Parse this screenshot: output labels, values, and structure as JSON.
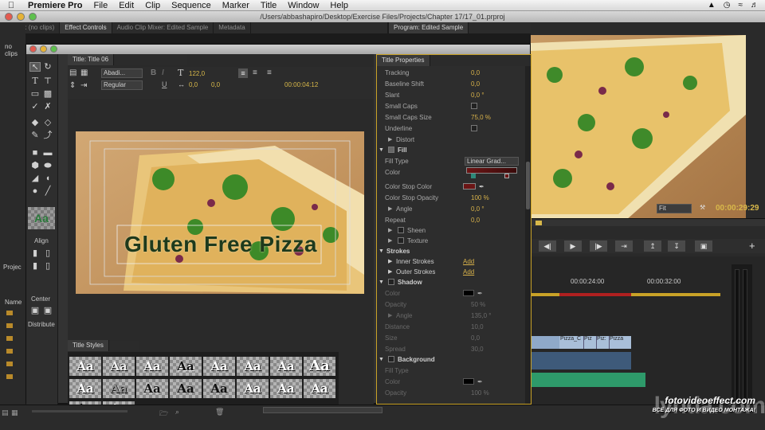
{
  "menubar": {
    "app": "Premiere Pro",
    "items": [
      "File",
      "Edit",
      "Clip",
      "Sequence",
      "Marker",
      "Title",
      "Window",
      "Help"
    ]
  },
  "window_path": "/Users/abbashapiro/Desktop/Exercise Files/Projects/Chapter 17/17_01.prproj",
  "panel_tabs": {
    "source": "Source: (no clips)",
    "effect_controls": "Effect Controls",
    "audio_mixer": "Audio Clip Mixer: Edited Sample",
    "metadata": "Metadata",
    "program": "Program: Edited Sample"
  },
  "left": {
    "no_clips": "no clips",
    "project": "Projec",
    "name": "Name"
  },
  "titler": {
    "tab": "Title: Title 06",
    "font_family": "Abadi...",
    "font_style": "Regular",
    "font_size": "122,0",
    "kerning": "0,0",
    "leading": "0,0",
    "timecode": "00:00:04:12",
    "canvas_text": "Gluten Free Pizza",
    "tools": {
      "align": "Align",
      "center": "Center",
      "distribute": "Distribute"
    },
    "style_sample": "Aa",
    "styles_tab": "Title Styles"
  },
  "props": {
    "tab": "Title Properties",
    "rows": [
      {
        "label": "Tracking",
        "value": "0,0"
      },
      {
        "label": "Baseline Shift",
        "value": "0,0"
      },
      {
        "label": "Slant",
        "value": "0,0 °"
      },
      {
        "label": "Small Caps",
        "value": ""
      },
      {
        "label": "Small Caps Size",
        "value": "75,0 %"
      },
      {
        "label": "Underline",
        "value": ""
      },
      {
        "label": "Distort",
        "value": ""
      },
      {
        "label": "Fill",
        "value": ""
      },
      {
        "label": "Fill Type",
        "value": "Linear Grad..."
      },
      {
        "label": "Color",
        "value": ""
      },
      {
        "label": "Color Stop Color",
        "value": ""
      },
      {
        "label": "Color Stop Opacity",
        "value": "100 %"
      },
      {
        "label": "Angle",
        "value": "0,0 °"
      },
      {
        "label": "Repeat",
        "value": "0,0"
      },
      {
        "label": "Sheen",
        "value": ""
      },
      {
        "label": "Texture",
        "value": ""
      },
      {
        "label": "Strokes",
        "value": ""
      },
      {
        "label": "Inner Strokes",
        "value": "Add"
      },
      {
        "label": "Outer Strokes",
        "value": "Add"
      },
      {
        "label": "Shadow",
        "value": ""
      },
      {
        "label": "Color",
        "value": ""
      },
      {
        "label": "Opacity",
        "value": "50 %"
      },
      {
        "label": "Angle",
        "value": "135,0 °"
      },
      {
        "label": "Distance",
        "value": "10,0"
      },
      {
        "label": "Size",
        "value": "0,0"
      },
      {
        "label": "Spread",
        "value": "30,0"
      },
      {
        "label": "Background",
        "value": ""
      },
      {
        "label": "Fill Type",
        "value": ""
      },
      {
        "label": "Color",
        "value": ""
      },
      {
        "label": "Opacity",
        "value": "100 %"
      }
    ]
  },
  "program": {
    "fit": "Fit",
    "timecode": "00:00:29:29"
  },
  "timeline": {
    "t1": "00:00:24:00",
    "t2": "00:00:32:00",
    "clips": [
      "Pizza_C",
      "Piz",
      "Piz:",
      "Pizza"
    ]
  },
  "watermark": {
    "site": "fotovideoeffect.com",
    "tagline": "ВСЁ ДЛЯ ФОТО И ВИДЕО МОНТАЖА!",
    "brand": "lynda.com"
  },
  "colors": {
    "fill_stop": "#6b1515",
    "canvas_text": "#1e3a1c",
    "selection_border": "#c9a227"
  }
}
